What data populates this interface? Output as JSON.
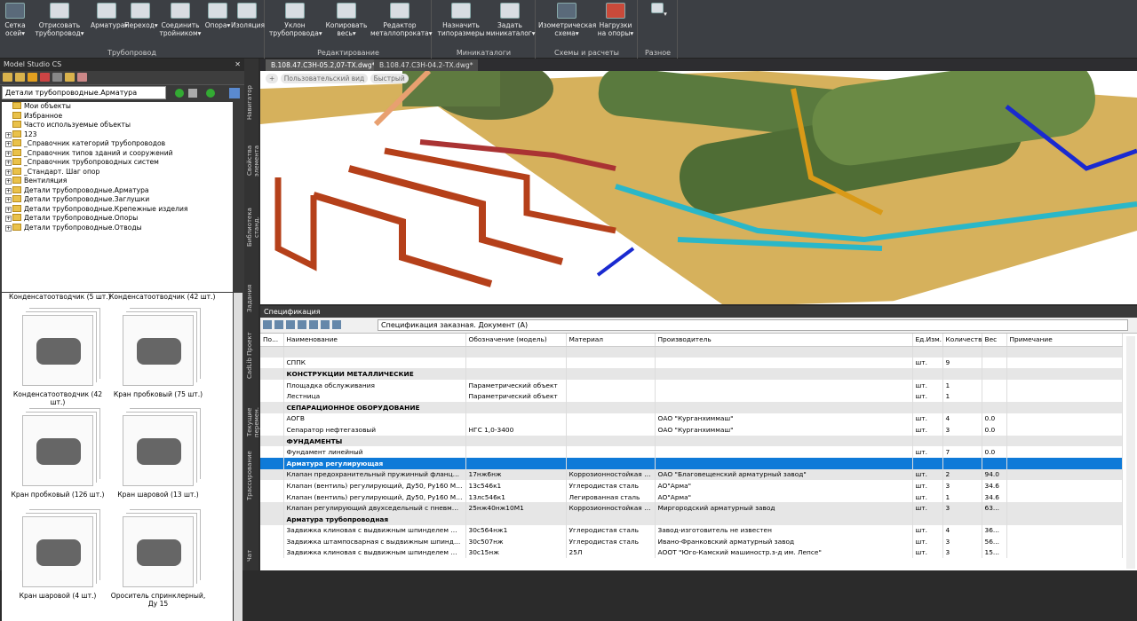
{
  "ribbon": {
    "groups": [
      {
        "name": "Трубопровод",
        "buttons": [
          {
            "label": "Сетка осей▾"
          },
          {
            "label": "Отрисовать трубопровод▾"
          },
          {
            "label": "Арматура▾"
          },
          {
            "label": "Переход▾"
          },
          {
            "label": "Соединить тройником▾"
          },
          {
            "label": "Опора▾"
          },
          {
            "label": "Изоляция"
          }
        ]
      },
      {
        "name": "Редактирование",
        "buttons": [
          {
            "label": "Уклон трубопровода▾"
          },
          {
            "label": "Копировать весь▾"
          },
          {
            "label": "Редактор металлопроката▾"
          }
        ]
      },
      {
        "name": "Миникаталоги",
        "buttons": [
          {
            "label": "Назначить типоразмеры"
          },
          {
            "label": "Задать миникаталог▾"
          }
        ]
      },
      {
        "name": "Схемы и расчеты",
        "buttons": [
          {
            "label": "Изометрическая схема▾"
          },
          {
            "label": "Нагрузки на опоры▾"
          }
        ]
      },
      {
        "name": "Разное",
        "buttons": [
          {
            "label": "▾"
          }
        ]
      }
    ]
  },
  "left": {
    "title": "Model Studio CS",
    "path": "Детали трубопроводные.Арматура",
    "tree": [
      {
        "label": "Мои объекты",
        "expand": ""
      },
      {
        "label": "Избранное",
        "expand": ""
      },
      {
        "label": "Часто используемые объекты",
        "expand": ""
      },
      {
        "label": "123",
        "expand": "+"
      },
      {
        "label": "_Справочник категорий трубопроводов",
        "expand": "+"
      },
      {
        "label": "_Справочник типов зданий и сооружений",
        "expand": "+"
      },
      {
        "label": "_Справочник трубопроводных систем",
        "expand": "+"
      },
      {
        "label": "_Стандарт. Шаг опор",
        "expand": "+"
      },
      {
        "label": "Вентиляция",
        "expand": "+"
      },
      {
        "label": "Детали трубопроводные.Арматура",
        "expand": "+"
      },
      {
        "label": "Детали трубопроводные.Заглушки",
        "expand": "+"
      },
      {
        "label": "Детали трубопроводные.Крепежные изделия",
        "expand": "+"
      },
      {
        "label": "Детали трубопроводные.Опоры",
        "expand": "+"
      },
      {
        "label": "Детали трубопроводные.Отводы",
        "expand": "+"
      }
    ],
    "thumb_top_labels": [
      "Конденсатоотводчик (5 шт.)",
      "Конденсатоотводчик (42 шт.)"
    ],
    "thumbs": [
      {
        "label": "Конденсатоотводчик (42 шт.)"
      },
      {
        "label": "Кран пробковый (75 шт.)"
      },
      {
        "label": "Кран пробковый (126 шт.)"
      },
      {
        "label": "Кран шаровой (13 шт.)"
      },
      {
        "label": "Кран шаровой (4 шт.)"
      },
      {
        "label": "Ороситель спринклерный, Ду 15"
      }
    ]
  },
  "sidetabs": [
    "Навигатор",
    "Свойства элемента",
    "Библиотека станд.",
    "Задания",
    "CadLib Проект",
    "Текущие перемен.",
    "Трассирование",
    "Чат"
  ],
  "doctabs": [
    "В.108.47.СЗН-05.2,07-ТХ.dwg*",
    "В.108.47.СЗН-04.2-ТХ.dwg*"
  ],
  "viewport": {
    "chips": [
      "Пользовательский вид",
      "Быстрый"
    ]
  },
  "spec": {
    "title": "Спецификация",
    "doc": "Спецификация заказная. Документ (А)",
    "columns": [
      "По...",
      "Наименование",
      "Обозначение (модель)",
      "Материал",
      "Производитель",
      "Ед.Изм.",
      "Количество",
      "Вес",
      "Примечание"
    ],
    "rows": [
      {
        "type": "blank",
        "c": [
          "",
          "",
          "",
          "",
          "",
          "",
          "",
          "",
          ""
        ]
      },
      {
        "type": "row",
        "c": [
          "",
          "СППК",
          "",
          "",
          "",
          "шт.",
          "9",
          "",
          ""
        ]
      },
      {
        "type": "sec",
        "c": [
          "",
          "КОНСТРУКЦИИ МЕТАЛЛИЧЕСКИЕ",
          "",
          "",
          "",
          "",
          "",
          "",
          ""
        ]
      },
      {
        "type": "row",
        "c": [
          "",
          "Площадка обслуживания",
          "Параметрический объект",
          "",
          "",
          "шт.",
          "1",
          "",
          ""
        ]
      },
      {
        "type": "row",
        "c": [
          "",
          "Лестница",
          "Параметрический объект",
          "",
          "",
          "шт.",
          "1",
          "",
          ""
        ]
      },
      {
        "type": "sec",
        "c": [
          "",
          "СЕПАРАЦИОННОЕ ОБОРУДОВАНИЕ",
          "",
          "",
          "",
          "",
          "",
          "",
          ""
        ]
      },
      {
        "type": "row",
        "c": [
          "",
          "АОГВ",
          "",
          "",
          "ОАО \"Курганхиммаш\"",
          "шт.",
          "4",
          "0.0",
          ""
        ]
      },
      {
        "type": "row",
        "c": [
          "",
          "Сепаратор нефтегазовый",
          "НГС 1,0-3400",
          "",
          "ОАО \"Курганхиммаш\"",
          "шт.",
          "3",
          "0.0",
          ""
        ]
      },
      {
        "type": "sec",
        "c": [
          "",
          "ФУНДАМЕНТЫ",
          "",
          "",
          "",
          "",
          "",
          "",
          ""
        ]
      },
      {
        "type": "row",
        "c": [
          "",
          "Фундамент линейный",
          "",
          "",
          "",
          "шт.",
          "7",
          "0.0",
          ""
        ]
      },
      {
        "type": "sel",
        "c": [
          "",
          "Арматура регулирующая",
          "",
          "",
          "",
          "",
          "",
          "",
          ""
        ]
      },
      {
        "type": "sec2",
        "c": [
          "",
          "Клапан предохранительный пружинный фланцевый, Ду...",
          "17нж6нж",
          "Коррозионностойкая ст...",
          "ОАО \"Благовещенский арматурный завод\"",
          "шт.",
          "2",
          "94.0",
          ""
        ]
      },
      {
        "type": "row",
        "c": [
          "",
          "Клапан (вентиль) регулирующий, Ду50, Ру160 МРа",
          "13с546к1",
          "Углеродистая сталь",
          "АО\"Арма\"",
          "шт.",
          "3",
          "34.6",
          ""
        ]
      },
      {
        "type": "row",
        "c": [
          "",
          "Клапан (вентиль) регулирующий, Ду50, Ру160 МРа",
          "13лс546к1",
          "Легированная сталь",
          "АО\"Арма\"",
          "шт.",
          "1",
          "34.6",
          ""
        ]
      },
      {
        "type": "sec2",
        "c": [
          "",
          "Клапан регулирующий двухседельный с пневматическ...",
          "25нж40нж10М1",
          "Коррозионностойкая ст...",
          "Миргородский арматурный завод",
          "шт.",
          "3",
          "63...",
          ""
        ]
      },
      {
        "type": "sec",
        "c": [
          "",
          "Арматура трубопроводная",
          "",
          "",
          "",
          "",
          "",
          "",
          ""
        ]
      },
      {
        "type": "row",
        "c": [
          "",
          "Задвижка клиновая с выдвижным шпинделем фланцев...",
          "30с564нж1",
          "Углеродистая сталь",
          "Завод-изготовитель не известен",
          "шт.",
          "4",
          "36...",
          ""
        ]
      },
      {
        "type": "row",
        "c": [
          "",
          "Задвижка штампосварная с выдвижным шпинделем п...",
          "30с507нж",
          "Углеродистая сталь",
          "Ивано-Франковский арматурный завод",
          "шт.",
          "3",
          "56...",
          ""
        ]
      },
      {
        "type": "row",
        "c": [
          "",
          "Задвижка клиновая с выдвижным шпинделем фланцев...",
          "30с15нж",
          "25Л",
          "АООТ \"Юго-Камский машиностр.з-д им. Лепсе\"",
          "шт.",
          "3",
          "15...",
          ""
        ]
      }
    ]
  }
}
